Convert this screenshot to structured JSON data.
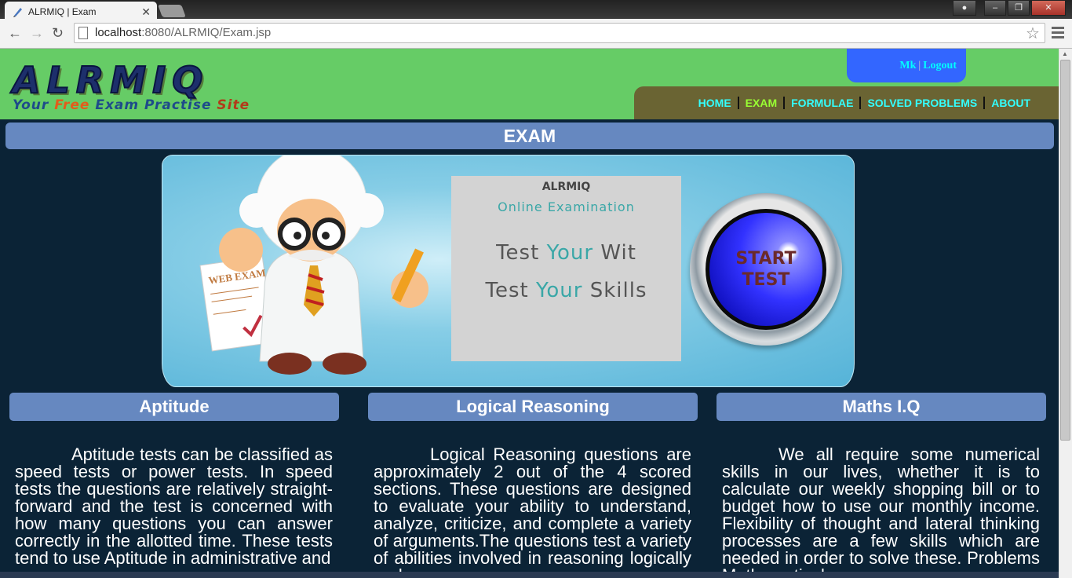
{
  "browser": {
    "tab_title": "ALRMIQ | Exam",
    "tab_close": "✕",
    "url_host": "localhost",
    "url_path": ":8080/ALRMIQ/Exam.jsp"
  },
  "header": {
    "logo_text": "ALRMIQ",
    "tagline": {
      "w1": "Your",
      "w2": "Free",
      "w3": "Exam Practise",
      "w4": "Site"
    },
    "user": {
      "name": "Mk",
      "sep": "|",
      "logout": "Logout"
    },
    "nav": [
      {
        "label": "HOME"
      },
      {
        "label": "EXAM"
      },
      {
        "label": "FORMULAE"
      },
      {
        "label": "SOLVED PROBLEMS"
      },
      {
        "label": "ABOUT"
      }
    ]
  },
  "main": {
    "section_title": "EXAM",
    "banner": {
      "brand": "ALRMIQ",
      "subtitle": "Online Examination",
      "line1_a": "Test ",
      "line1_b": "Your",
      "line1_c": " Wit",
      "line2_a": "Test ",
      "line2_b": "Your",
      "line2_c": " Skills",
      "paper_title": "WEB EXAM",
      "button_line1": "START",
      "button_line2": "TEST"
    },
    "columns": [
      {
        "title": "Aptitude",
        "text": "Aptitude tests can be classified as speed tests or power tests. In speed tests the questions are relatively straight-forward and the test is concerned with how many questions you can answer correctly in the allotted time. These tests tend to use Aptitude in administrative and"
      },
      {
        "title": "Logical Reasoning",
        "text": "Logical Reasoning questions are approximately 2 out of the 4 scored sections. These questions are designed to evaluate your ability to understand, analyze, criticize, and complete a variety of arguments.The questions test a variety of abilities involved in reasoning logically and"
      },
      {
        "title": "Maths I.Q",
        "text": "We all require some numerical skills in our lives, whether it is to calculate our weekly shopping bill or to budget how to use our monthly income. Flexibility of thought and lateral thinking processes are a few skills which are needed in order to solve these. Problems Mathematical"
      }
    ]
  },
  "colors": {
    "header_bg": "#66cc66",
    "page_bg": "#0b2336",
    "bar_bg": "#6688c0",
    "nav_bg": "#6a6433",
    "nav_text": "#33ffff",
    "nav_active": "#99ff33",
    "user_box": "#3366ff"
  }
}
